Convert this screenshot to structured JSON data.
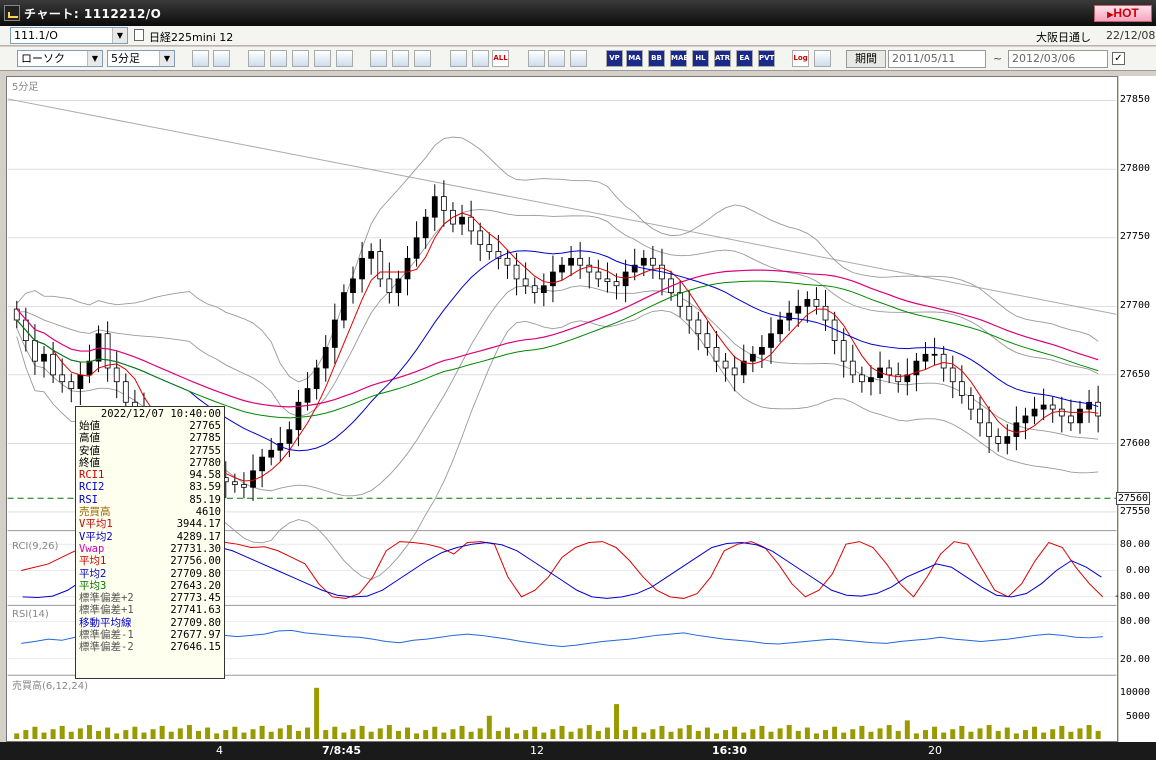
{
  "window": {
    "title": "チャート: 1112212/O",
    "hot_label": "HOT"
  },
  "toolbar1": {
    "symbol_code": "111.1/O",
    "symbol_name": "日経225mini 12",
    "exchange": "大阪日通し",
    "date": "22/12/08"
  },
  "toolbar2": {
    "chart_type": "ローソク",
    "interval": "5分足",
    "period_label": "期間",
    "date_from": "2011/05/11",
    "date_sep": "~",
    "date_to": "2012/03/06",
    "buttons": [
      "zoom",
      "grid",
      "cursor",
      "search",
      "bars",
      "cross",
      "info",
      "draw",
      "pointer",
      "undo",
      "cb1",
      "cb2",
      "ALL",
      "gear",
      "pen",
      "color",
      "VP",
      "MA",
      "BB",
      "MAE",
      "HL",
      "ATR",
      "EA",
      "PVT",
      "Log",
      "print"
    ]
  },
  "chart": {
    "main_label": "5分足",
    "rci_label": "RCI(9,26)",
    "rsi_label": "RSI(14)",
    "vol_label": "売買高(6,12,24)",
    "price_ticks": [
      "27850",
      "27800",
      "27750",
      "27700",
      "27650",
      "27600",
      "27550"
    ],
    "current_price_tag": "27560",
    "rci_ticks": [
      "80.00",
      "0.00",
      "-80.00"
    ],
    "rsi_ticks": [
      "80.00",
      "20.00"
    ],
    "vol_ticks": [
      "10000",
      "5000"
    ],
    "x_labels": [
      "4",
      "7/8:45",
      "12",
      "16:30",
      "20"
    ]
  },
  "data_box": {
    "datetime": "2022/12/07  10:40:00",
    "rows": [
      {
        "k": "始値",
        "v": "27765",
        "c": "#000"
      },
      {
        "k": "高値",
        "v": "27785",
        "c": "#000"
      },
      {
        "k": "安値",
        "v": "27755",
        "c": "#000"
      },
      {
        "k": "終値",
        "v": "27780",
        "c": "#000"
      },
      {
        "k": "RCI1",
        "v": "94.58",
        "c": "#c00"
      },
      {
        "k": "RCI2",
        "v": "83.59",
        "c": "#00c"
      },
      {
        "k": "RSI",
        "v": "85.19",
        "c": "#00c"
      },
      {
        "k": "売買高",
        "v": "4610",
        "c": "#996600"
      },
      {
        "k": "V平均1",
        "v": "3944.17",
        "c": "#c00"
      },
      {
        "k": "V平均2",
        "v": "4289.17",
        "c": "#00c"
      },
      {
        "k": "Vwap",
        "v": "27731.30",
        "c": "#c0c"
      },
      {
        "k": "平均1",
        "v": "27756.00",
        "c": "#c00"
      },
      {
        "k": "平均2",
        "v": "27709.80",
        "c": "#00c"
      },
      {
        "k": "平均3",
        "v": "27643.20",
        "c": "#070"
      },
      {
        "k": "標準偏差+2",
        "v": "27773.45",
        "c": "#555"
      },
      {
        "k": "標準偏差+1",
        "v": "27741.63",
        "c": "#555"
      },
      {
        "k": "移動平均線",
        "v": "27709.80",
        "c": "#00c"
      },
      {
        "k": "標準偏差-1",
        "v": "27677.97",
        "c": "#555"
      },
      {
        "k": "標準偏差-2",
        "v": "27646.15",
        "c": "#555"
      }
    ]
  },
  "colors": {
    "up": "#000000",
    "down": "#ffffff",
    "ma1": "#dd0000",
    "ma2": "#0000cc",
    "ma3": "#008800",
    "vwap": "#dd0077",
    "bb": "#888888"
  },
  "chart_data": {
    "type": "candlestick",
    "close": [
      27690,
      27675,
      27660,
      27665,
      27650,
      27645,
      27640,
      27650,
      27660,
      27680,
      27655,
      27645,
      27630,
      27625,
      27615,
      27605,
      27600,
      27595,
      27590,
      27585,
      27580,
      27578,
      27575,
      27572,
      27570,
      27568,
      27580,
      27590,
      27595,
      27600,
      27610,
      27630,
      27640,
      27655,
      27670,
      27690,
      27710,
      27720,
      27735,
      27740,
      27720,
      27710,
      27720,
      27735,
      27750,
      27765,
      27780,
      27770,
      27760,
      27765,
      27755,
      27745,
      27740,
      27735,
      27730,
      27720,
      27715,
      27710,
      27715,
      27725,
      27730,
      27735,
      27730,
      27725,
      27720,
      27718,
      27715,
      27725,
      27730,
      27735,
      27730,
      27720,
      27710,
      27700,
      27690,
      27680,
      27670,
      27660,
      27655,
      27650,
      27660,
      27665,
      27670,
      27680,
      27690,
      27695,
      27700,
      27705,
      27700,
      27690,
      27675,
      27660,
      27650,
      27645,
      27648,
      27655,
      27650,
      27645,
      27650,
      27660,
      27665,
      27665,
      27655,
      27645,
      27635,
      27625,
      27615,
      27605,
      27600,
      27605,
      27615,
      27620,
      27625,
      27628,
      27625,
      27620,
      27615,
      27625,
      27630,
      27620
    ],
    "rci1": [
      0,
      10,
      20,
      40,
      60,
      75,
      85,
      80,
      70,
      85,
      88,
      85,
      82,
      87,
      88,
      86,
      80,
      70,
      72,
      60,
      40,
      20,
      -40,
      -80,
      -85,
      -70,
      -20,
      60,
      88,
      85,
      80,
      70,
      50,
      85,
      88,
      80,
      -20,
      -80,
      -60,
      -20,
      40,
      70,
      85,
      88,
      70,
      30,
      -20,
      -60,
      -80,
      -85,
      -70,
      -20,
      60,
      80,
      88,
      70,
      20,
      -40,
      -80,
      -60,
      -10,
      80,
      88,
      70,
      20,
      -40,
      -80,
      -20,
      50,
      88,
      80,
      10,
      -60,
      -80,
      -40,
      30,
      85,
      70,
      10,
      -40,
      -80
    ],
    "rci2": [
      -80,
      -82,
      -78,
      -60,
      -30,
      0,
      30,
      60,
      80,
      85,
      88,
      85,
      80,
      72,
      60,
      40,
      20,
      0,
      -20,
      -40,
      -60,
      -75,
      -80,
      -78,
      -60,
      -30,
      0,
      30,
      55,
      70,
      80,
      85,
      78,
      60,
      30,
      0,
      -30,
      -60,
      -80,
      -85,
      -80,
      -70,
      -50,
      -20,
      10,
      40,
      70,
      82,
      85,
      78,
      60,
      30,
      0,
      -30,
      -60,
      -75,
      -78,
      -70,
      -50,
      -20,
      0,
      20,
      10,
      -20,
      -50,
      -75,
      -80,
      -70,
      -40,
      0,
      30,
      10,
      -20
    ],
    "rsi": [
      45,
      48,
      52,
      50,
      55,
      58,
      60,
      62,
      58,
      55,
      57,
      60,
      62,
      64,
      60,
      58,
      56,
      58,
      60,
      65,
      66,
      62,
      60,
      58,
      56,
      55,
      52,
      48,
      46,
      50,
      52,
      55,
      58,
      60,
      58,
      55,
      52,
      48,
      45,
      42,
      40,
      42,
      45,
      48,
      50,
      52,
      55,
      58,
      60,
      62,
      58,
      55,
      52,
      50,
      48,
      45,
      44,
      46,
      48,
      50,
      52,
      50,
      48,
      46,
      45,
      48,
      50,
      52,
      55,
      52,
      50,
      48,
      50,
      52,
      55,
      58,
      60,
      58,
      55,
      54,
      56
    ],
    "volume_spikes": [
      {
        "i": 33,
        "v": 11000
      },
      {
        "i": 52,
        "v": 5000
      },
      {
        "i": 66,
        "v": 7500
      },
      {
        "i": 98,
        "v": 4000
      }
    ],
    "price_range": [
      27540,
      27860
    ],
    "rci_range": [
      -100,
      100
    ],
    "rsi_range": [
      0,
      100
    ],
    "vol_range": [
      0,
      12000
    ]
  }
}
